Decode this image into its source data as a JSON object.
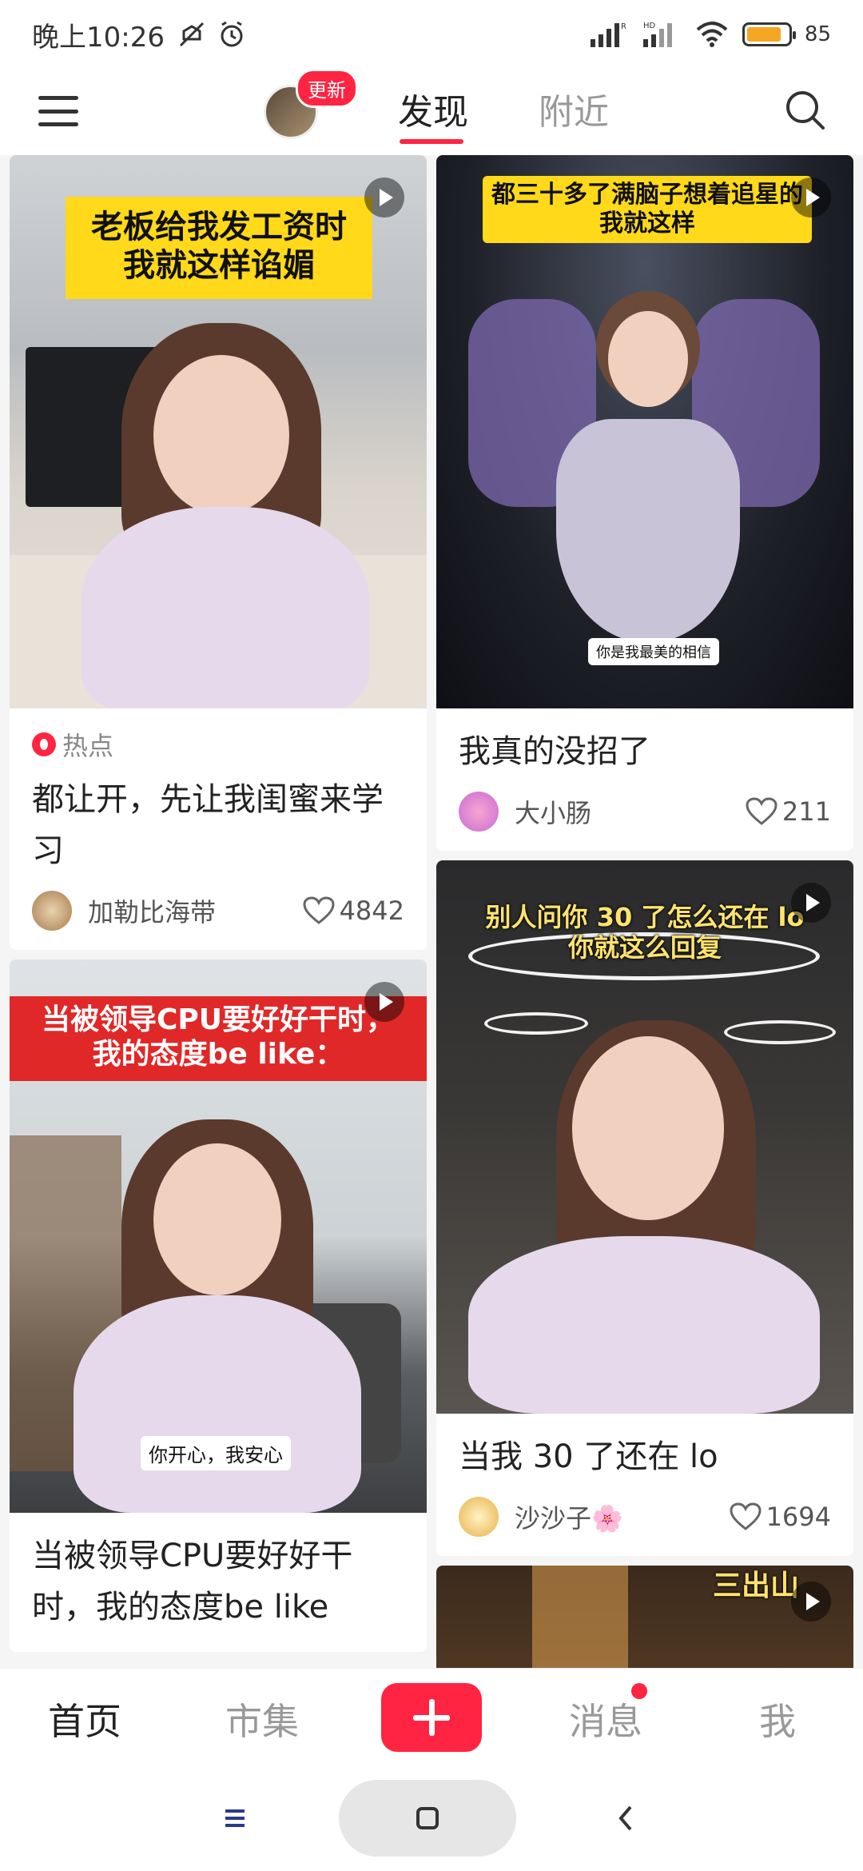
{
  "status_bar": {
    "time": "晚上10:26",
    "battery_percent": "85",
    "battery_level": 0.85,
    "signal_labels": [
      "R",
      "HD"
    ]
  },
  "header": {
    "update_badge": "更新",
    "tabs": [
      {
        "label": "发现",
        "active": true
      },
      {
        "label": "附近",
        "active": false
      }
    ]
  },
  "feed": {
    "left": [
      {
        "cover_caption_lines": [
          "老板给我发工资时",
          "我就这样谄媚"
        ],
        "cover_caption_style": "yellow",
        "hot_tag": "热点",
        "title": "都让开，先让我闺蜜来学习",
        "author": "加勒比海带",
        "likes": "4842"
      },
      {
        "cover_caption_lines": [
          "当被领导CPU要好好干时，",
          "我的态度be like："
        ],
        "cover_caption_style": "red",
        "subtitle": "你开心，我安心",
        "title": "当被领导CPU要好好干时，我的态度be like",
        "author": "",
        "likes": ""
      }
    ],
    "right": [
      {
        "cover_caption_lines": [
          "都三十多了满脑子想着追星的",
          "我就这样"
        ],
        "cover_caption_style": "yellow",
        "subtitle": "你是我最美的相信",
        "title": "我真的没招了",
        "author": "大小肠",
        "likes": "211"
      },
      {
        "cover_caption_lines": [
          "别人问你 30 了怎么还在 lo",
          "你就这么回复"
        ],
        "cover_caption_style": "outline",
        "title": "当我 30 了还在 lo",
        "author": "沙沙子🌸",
        "likes": "1694"
      },
      {
        "cover_caption_lines": [
          "三出山"
        ],
        "cover_caption_style": "outline"
      }
    ]
  },
  "tabbar": {
    "items": [
      "首页",
      "市集",
      "消息",
      "我"
    ],
    "active": "首页",
    "add_label": "+"
  },
  "colors": {
    "accent": "#ff2442",
    "caption_yellow": "#ffd91a",
    "caption_red": "#e02828"
  },
  "icons": [
    "menu-icon",
    "search-icon",
    "play-icon",
    "heart-icon",
    "fire-icon",
    "plus-icon",
    "back-icon",
    "recent-apps-icon",
    "home-square-icon",
    "mute-icon",
    "alarm-icon",
    "wifi-icon",
    "signal-icon"
  ]
}
